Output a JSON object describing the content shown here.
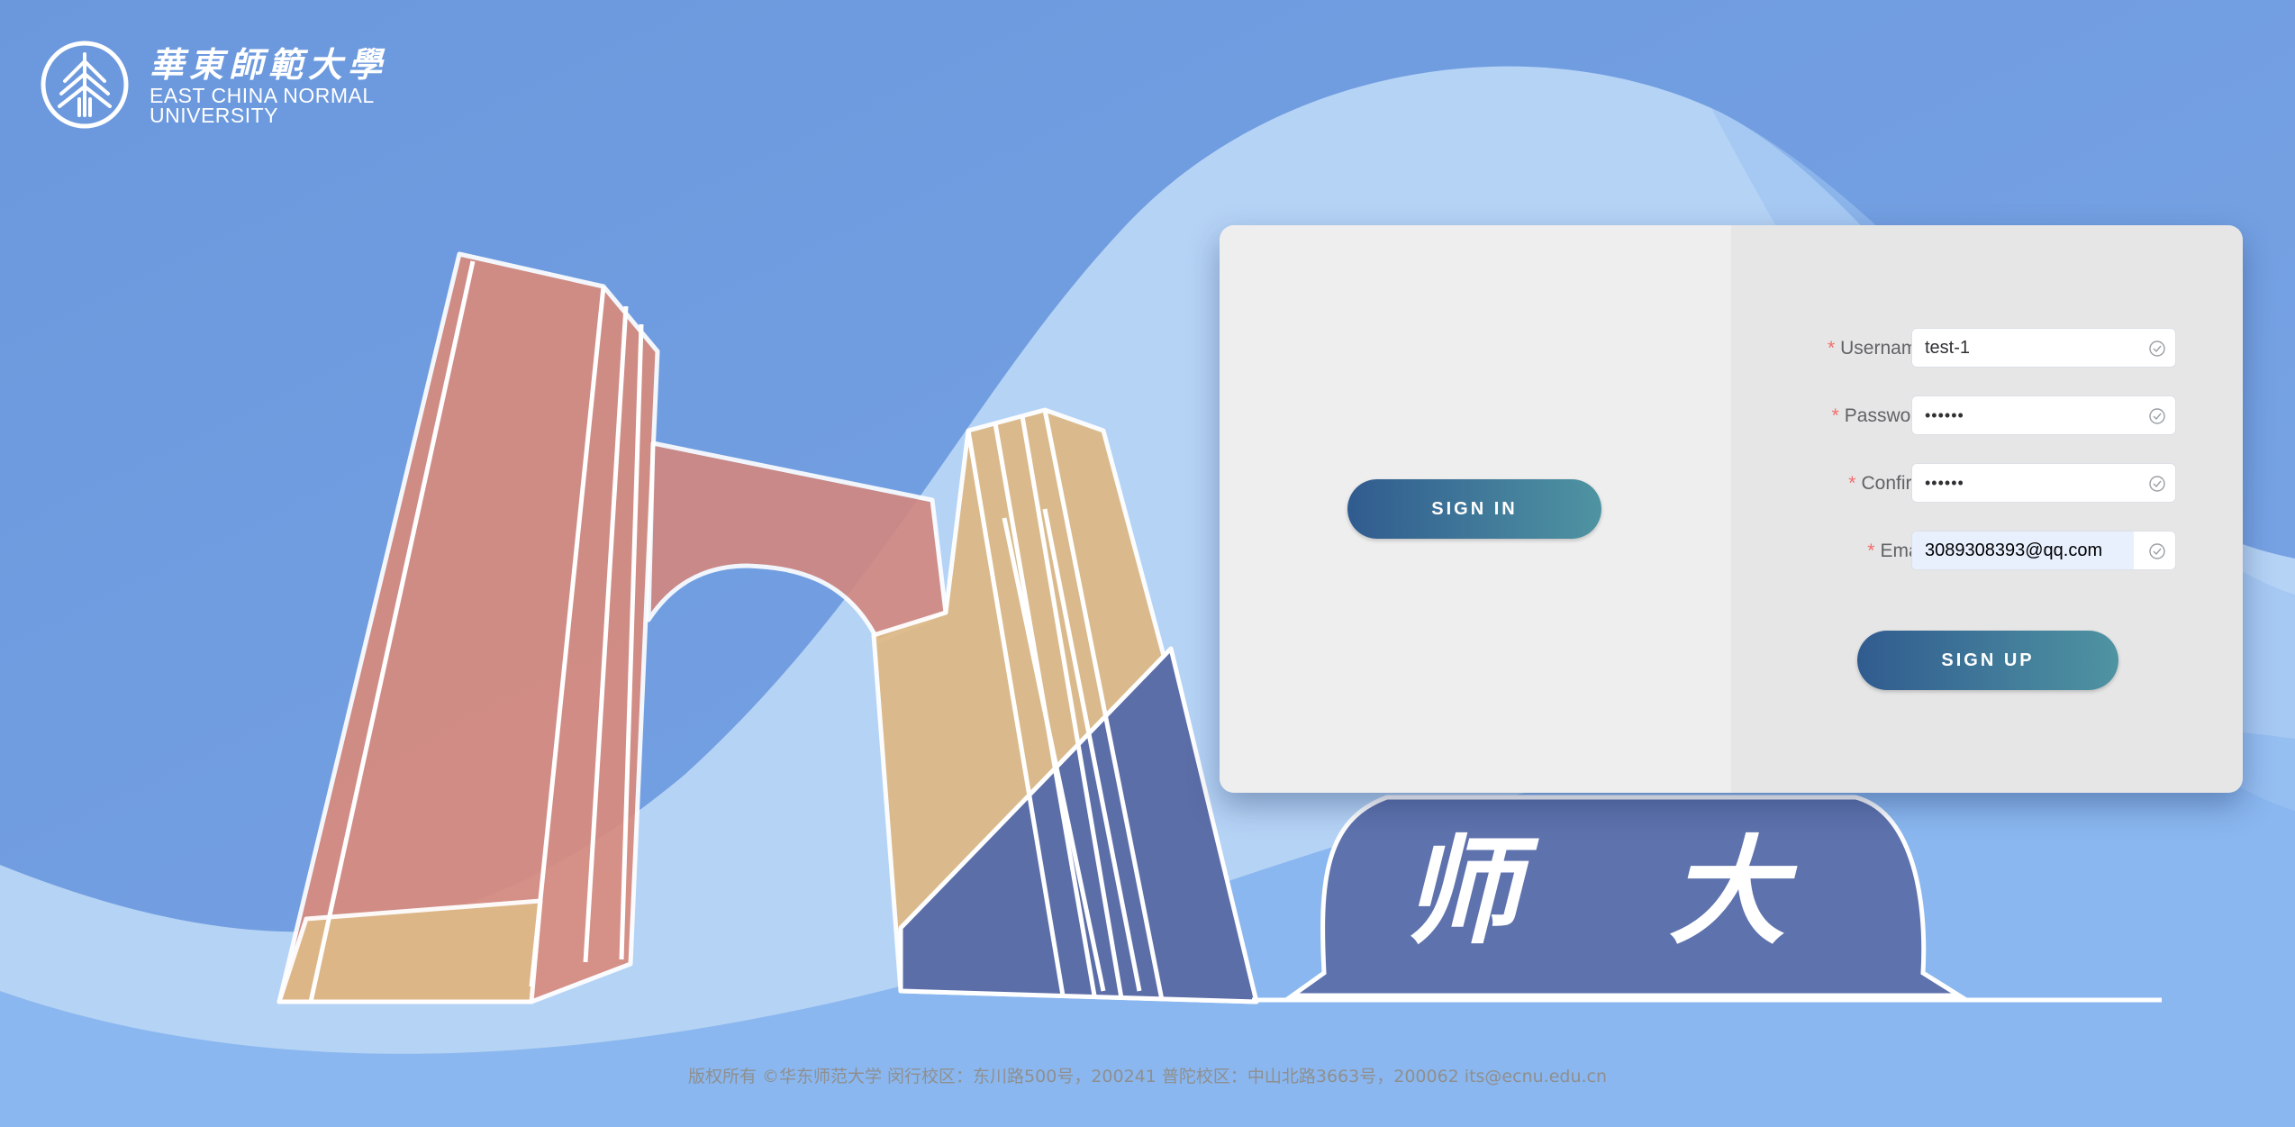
{
  "logo": {
    "cn_name": "華東師範大學",
    "en_line1": "EAST CHINA NORMAL",
    "en_line2": "UNIVERSITY"
  },
  "illustration": {
    "signboard_text": "师 大"
  },
  "card": {
    "signin_label": "SIGN IN",
    "signup_label": "SIGN UP",
    "fields": [
      {
        "label": "Username",
        "value": "test-1",
        "required": true,
        "status_icon": "check-circle-icon"
      },
      {
        "label": "Password",
        "value": "••••••",
        "required": true,
        "status_icon": "check-circle-icon"
      },
      {
        "label": "Confirm",
        "value": "••••••",
        "required": true,
        "status_icon": "check-circle-icon"
      },
      {
        "label": "Email",
        "value": "3089308393@qq.com",
        "required": true,
        "status_icon": "check-circle-icon"
      }
    ],
    "required_mark": "*"
  },
  "footer": {
    "text": "版权所有 ©华东师范大学 闵行校区：东川路500号，200241 普陀校区：中山北路3663号，200062 its@ecnu.edu.cn"
  },
  "colors": {
    "sky": "#6e9ae0",
    "button_start": "#305b8f",
    "button_end": "#4f94a2",
    "required": "#f56c6c"
  }
}
